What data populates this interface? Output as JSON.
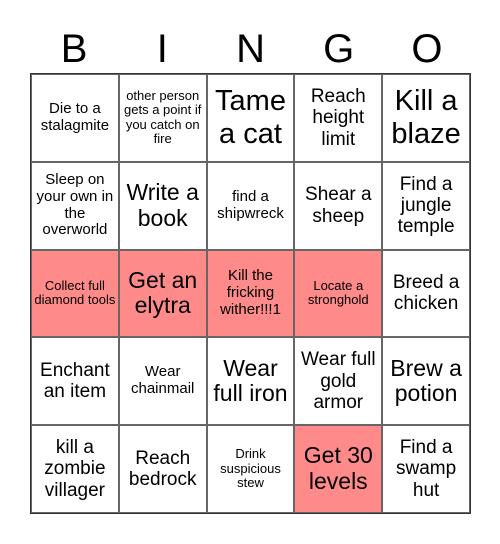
{
  "header": {
    "letters": [
      "B",
      "I",
      "N",
      "G",
      "O"
    ]
  },
  "colors": {
    "marked": "#ff8a8a",
    "unmarked": "#ffffff"
  },
  "cells": [
    {
      "text": "Die to a stalagmite",
      "marked": false,
      "size": "s-sm"
    },
    {
      "text": "other person gets a point if you catch on fire",
      "marked": false,
      "size": "s-xs"
    },
    {
      "text": "Tame a cat",
      "marked": false,
      "size": "s-xl"
    },
    {
      "text": "Reach height limit",
      "marked": false,
      "size": "s-md"
    },
    {
      "text": "Kill a blaze",
      "marked": false,
      "size": "s-xl"
    },
    {
      "text": "Sleep on your own in the overworld",
      "marked": false,
      "size": "s-sm"
    },
    {
      "text": "Write a book",
      "marked": false,
      "size": "s-lg"
    },
    {
      "text": "find a shipwreck",
      "marked": false,
      "size": "s-sm"
    },
    {
      "text": "Shear a sheep",
      "marked": false,
      "size": "s-md"
    },
    {
      "text": "Find a jungle temple",
      "marked": false,
      "size": "s-md"
    },
    {
      "text": "Collect full diamond tools",
      "marked": true,
      "size": "s-xs"
    },
    {
      "text": "Get an elytra",
      "marked": true,
      "size": "s-lg"
    },
    {
      "text": "Kill the fricking wither!!!1",
      "marked": true,
      "size": "s-sm"
    },
    {
      "text": "Locate a stronghold",
      "marked": true,
      "size": "s-xs"
    },
    {
      "text": "Breed a chicken",
      "marked": false,
      "size": "s-md"
    },
    {
      "text": "Enchant an item",
      "marked": false,
      "size": "s-md"
    },
    {
      "text": "Wear chainmail",
      "marked": false,
      "size": "s-sm"
    },
    {
      "text": "Wear full iron",
      "marked": false,
      "size": "s-lg"
    },
    {
      "text": "Wear full gold armor",
      "marked": false,
      "size": "s-md"
    },
    {
      "text": "Brew a potion",
      "marked": false,
      "size": "s-lg"
    },
    {
      "text": "kill a zombie villager",
      "marked": false,
      "size": "s-md"
    },
    {
      "text": "Reach bedrock",
      "marked": false,
      "size": "s-md"
    },
    {
      "text": "Drink suspicious stew",
      "marked": false,
      "size": "s-xs"
    },
    {
      "text": "Get 30 levels",
      "marked": true,
      "size": "s-lg"
    },
    {
      "text": "Find a swamp hut",
      "marked": false,
      "size": "s-md"
    }
  ]
}
